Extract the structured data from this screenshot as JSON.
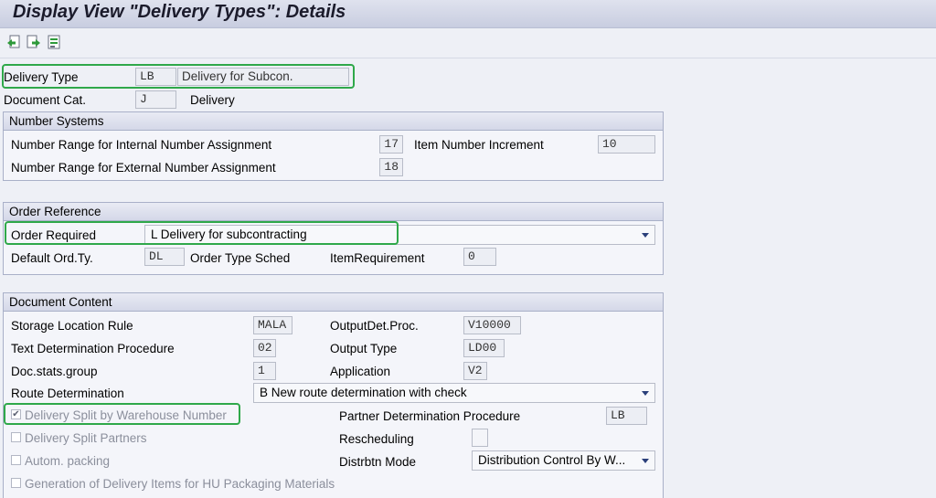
{
  "window": {
    "title": "Display View \"Delivery Types\": Details"
  },
  "toolbar": {
    "icons": [
      "previous-entry-icon",
      "next-entry-icon",
      "other-entry-icon"
    ]
  },
  "header": {
    "delivery_type_label": "Delivery Type",
    "delivery_type_value": "LB",
    "delivery_type_desc": "Delivery for Subcon.",
    "document_cat_label": "Document Cat.",
    "document_cat_value": "J",
    "document_cat_desc": "Delivery"
  },
  "number_systems": {
    "title": "Number Systems",
    "internal_label": "Number Range for Internal Number Assignment",
    "internal_value": "17",
    "item_increment_label": "Item Number Increment",
    "item_increment_value": "10",
    "external_label": "Number Range for External Number Assignment",
    "external_value": "18"
  },
  "order_reference": {
    "title": "Order Reference",
    "order_required_label": "Order Required",
    "order_required_value": "L Delivery for subcontracting",
    "default_ord_label": "Default Ord.Ty.",
    "default_ord_value": "DL",
    "order_type_sched_label": "Order Type Sched",
    "item_requirement_label": "ItemRequirement",
    "item_requirement_value": "0"
  },
  "document_content": {
    "title": "Document Content",
    "storage_rule_label": "Storage Location Rule",
    "storage_rule_value": "MALA",
    "output_det_label": "OutputDet.Proc.",
    "output_det_value": "V10000",
    "text_det_label": "Text Determination Procedure",
    "text_det_value": "02",
    "output_type_label": "Output Type",
    "output_type_value": "LD00",
    "doc_stats_label": "Doc.stats.group",
    "doc_stats_value": "1",
    "application_label": "Application",
    "application_value": "V2",
    "route_det_label": "Route Determination",
    "route_det_value": "B New route determination with check",
    "split_wh_label": "Delivery Split by Warehouse Number",
    "split_wh_checked": true,
    "partner_det_label": "Partner Determination Procedure",
    "partner_det_value": "LB",
    "split_partners_label": "Delivery Split Partners",
    "rescheduling_label": "Rescheduling",
    "autom_packing_label": "Autom. packing",
    "distrbtn_label": "Distrbtn Mode",
    "distrbtn_value": "Distribution Control By W...",
    "gen_items_label": "Generation of Delivery Items for HU Packaging Materials"
  },
  "colors": {
    "highlight": "#2fa84a",
    "group_border": "#a9b0c8",
    "dropdown_arrow": "#2a3f7a"
  }
}
